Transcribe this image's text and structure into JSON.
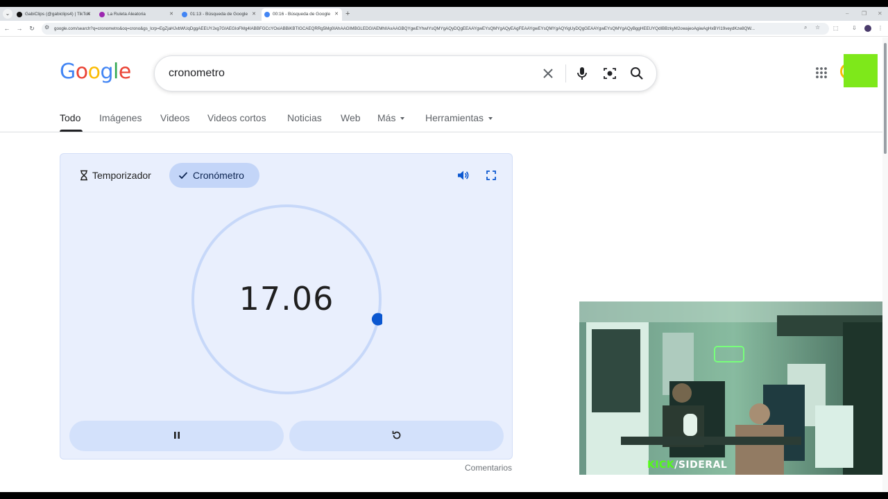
{
  "browser": {
    "tabs": [
      {
        "title": "GabiClips (@gabiclips4) | TikTok",
        "favicon_color": "#111111"
      },
      {
        "title": "La Ruleta Aleatoria",
        "favicon_color": "#9c27b0"
      },
      {
        "title": "01:13 - Búsqueda de Google",
        "favicon_color": "#4285f4"
      },
      {
        "title": "00:16 - Búsqueda de Google",
        "favicon_color": "#4285f4"
      }
    ],
    "url": "google.com/search?q=cronometro&oq=crono&gs_lcrp=EgZjaHJvbWUqDggAEEUYJxg7GIAEGIoFMg4IABBFGCcYOxiABBiKBTIGCAEQRRg5Mg0IAhAAGIMBGLEDGIAEMhIIAxAAGBQYgwEYhwIYsQMYgAQyDQgEEAAYgwEYsQMYgAQyEAgFEAAYgwEYsQMYgAQYigUyDQgGEAAYgwEYsQMYgAQyBggHEEUYQdIBBzkyM2owajeoAgiwAgHxBYI19veydKze8QW..."
  },
  "search": {
    "query": "cronometro",
    "logo_letters": [
      "G",
      "o",
      "o",
      "g",
      "l",
      "e"
    ]
  },
  "nav": {
    "tabs": [
      "Todo",
      "Imágenes",
      "Videos",
      "Videos cortos",
      "Noticias",
      "Web",
      "Más",
      "Herramientas"
    ]
  },
  "stopwatch": {
    "timer_label": "Temporizador",
    "stopwatch_label": "Cronómetro",
    "time": "17.06",
    "dial_progress": 0.284
  },
  "feedback_label": "Comentarios",
  "overlay": {
    "kick_prefix": "KICK",
    "kick_sep": "/",
    "kick_channel": "SIDERAL"
  },
  "colors": {
    "accent": "#0b57d0",
    "card_bg": "#e9effd",
    "chip_selected": "#c3d5f8",
    "kick_green": "#53fc18"
  }
}
